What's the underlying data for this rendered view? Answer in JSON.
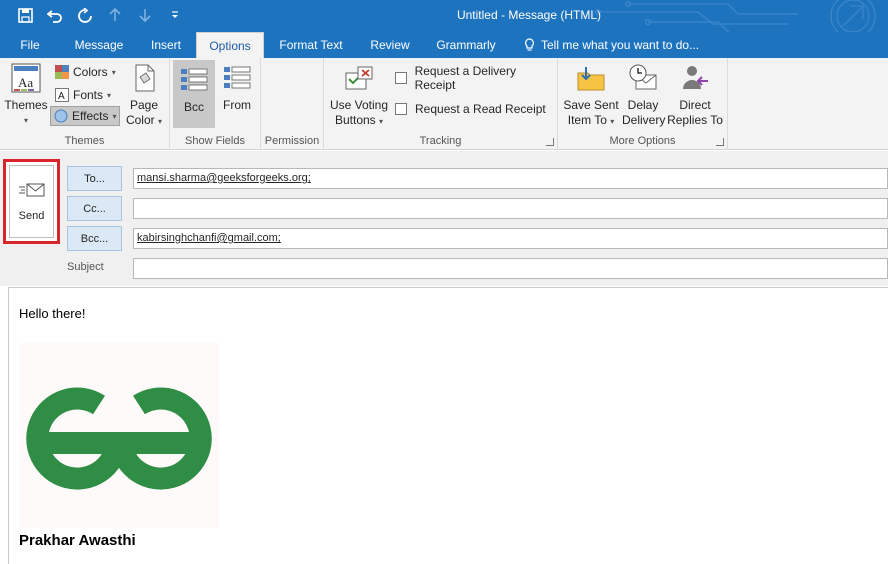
{
  "window": {
    "title": "Untitled - Message (HTML)"
  },
  "colors": {
    "titlebar": "#1e73be",
    "accent": "#1e5aa8",
    "send_highlight": "#d9262c",
    "logo_green": "#2f8d46"
  },
  "quick_access": [
    {
      "icon": "save-icon"
    },
    {
      "icon": "undo-icon"
    },
    {
      "icon": "redo-icon"
    },
    {
      "icon": "up-arrow-icon"
    },
    {
      "icon": "down-arrow-icon"
    },
    {
      "icon": "customize-icon"
    }
  ],
  "tabs": [
    {
      "label": "File"
    },
    {
      "label": "Message"
    },
    {
      "label": "Insert"
    },
    {
      "label": "Options",
      "active": true
    },
    {
      "label": "Format Text"
    },
    {
      "label": "Review"
    },
    {
      "label": "Grammarly"
    }
  ],
  "tell_me": "Tell me what you want to do...",
  "ribbon": {
    "themes_group": {
      "label": "Themes",
      "themes_line1": "Themes",
      "colors": "Colors",
      "fonts": "Fonts",
      "effects": "Effects",
      "page_color_line1": "Page",
      "page_color_line2": "Color"
    },
    "show_fields_group": {
      "label": "Show Fields",
      "bcc": "Bcc",
      "from": "From"
    },
    "permission_group": {
      "label": "Permission"
    },
    "tracking_group": {
      "label": "Tracking",
      "voting_line1": "Use Voting",
      "voting_line2": "Buttons",
      "delivery_receipt": "Request a Delivery Receipt",
      "read_receipt": "Request a Read Receipt"
    },
    "more_options_group": {
      "label": "More Options",
      "save_sent_line1": "Save Sent",
      "save_sent_line2": "Item To",
      "delay_line1": "Delay",
      "delay_line2": "Delivery",
      "direct_line1": "Direct",
      "direct_line2": "Replies To"
    }
  },
  "compose": {
    "send": "Send",
    "to_button": "To...",
    "cc_button": "Cc...",
    "bcc_button": "Bcc...",
    "subject_label": "Subject",
    "to_value": "mansi.sharma@geeksforgeeks.org;",
    "cc_value": "",
    "bcc_value": "kabirsinghchanfi@gmail.com;",
    "subject_value": ""
  },
  "body": {
    "greeting": "Hello there!",
    "signature": "Prakhar Awasthi"
  }
}
